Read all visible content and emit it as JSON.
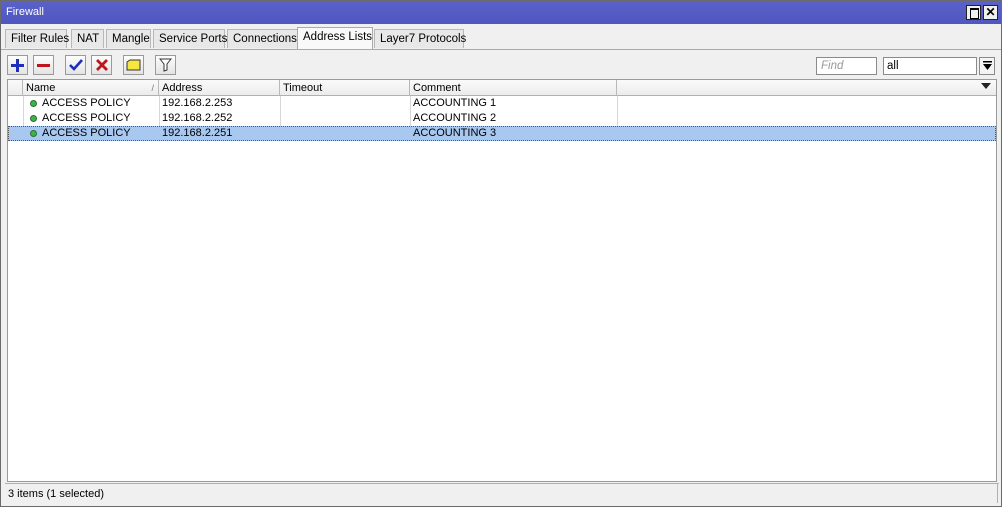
{
  "window": {
    "title": "Firewall"
  },
  "tabs": [
    {
      "label": "Filter Rules"
    },
    {
      "label": "NAT"
    },
    {
      "label": "Mangle"
    },
    {
      "label": "Service Ports"
    },
    {
      "label": "Connections"
    },
    {
      "label": "Address Lists",
      "active": true
    },
    {
      "label": "Layer7 Protocols"
    }
  ],
  "toolbar": {
    "buttons": [
      "add-icon",
      "remove-icon",
      "enable-icon",
      "disable-icon",
      "comment-icon",
      "filter-icon"
    ],
    "find_placeholder": "Find",
    "filter_value": "all"
  },
  "table": {
    "columns": [
      "Name",
      "Address",
      "Timeout",
      "Comment"
    ],
    "rows": [
      {
        "name": "ACCESS POLICY",
        "address": "192.168.2.253",
        "timeout": "",
        "comment": "ACCOUNTING 1"
      },
      {
        "name": "ACCESS POLICY",
        "address": "192.168.2.252",
        "timeout": "",
        "comment": "ACCOUNTING 2"
      },
      {
        "name": "ACCESS POLICY",
        "address": "192.168.2.251",
        "timeout": "",
        "comment": "ACCOUNTING 3",
        "selected": true
      }
    ]
  },
  "status": {
    "text": "3 items (1 selected)"
  },
  "colors": {
    "titlebar": "#5a62c8",
    "selection": "#a8c8ef",
    "status_dot": "#3bb54a"
  }
}
